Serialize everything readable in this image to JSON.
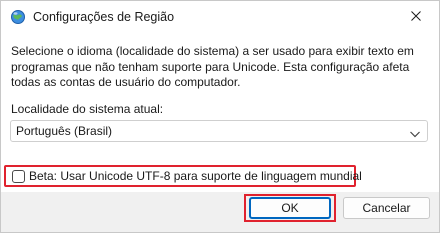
{
  "window": {
    "title": "Configurações de Região",
    "title_icon": "globe-icon",
    "close_icon": "close-icon"
  },
  "content": {
    "description": "Selecione o idioma (localidade do sistema) a ser usado para exibir texto em programas que não tenham suporte para Unicode. Esta configuração afeta todas as contas de usuário do computador.",
    "locale_label": "Localidade do sistema atual:",
    "locale_select": {
      "value": "Português (Brasil)",
      "icon": "chevron-down-icon"
    },
    "beta_checkbox": {
      "label": "Beta: Usar Unicode UTF-8 para suporte de linguagem mundial",
      "checked": false
    }
  },
  "footer": {
    "ok_label": "OK",
    "cancel_label": "Cancelar"
  },
  "colors": {
    "highlight": "#e0222e",
    "accent": "#0067c0"
  }
}
